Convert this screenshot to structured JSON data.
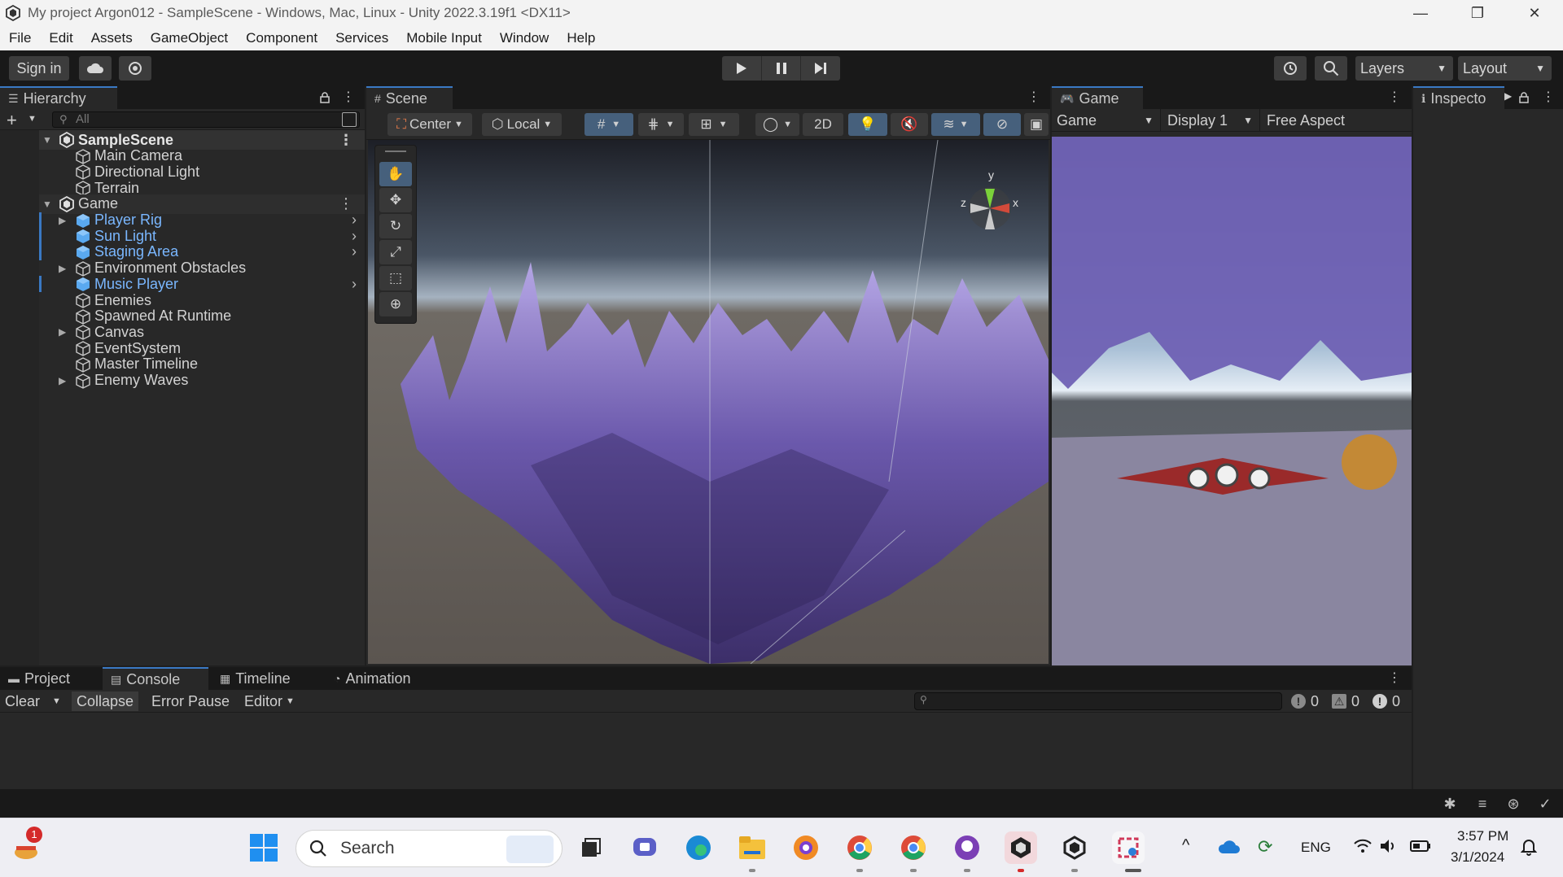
{
  "window": {
    "title": "My project Argon012 - SampleScene - Windows, Mac, Linux - Unity 2022.3.19f1 <DX11>",
    "minimize": "—",
    "maximize": "❐",
    "close": "✕"
  },
  "menu": [
    "File",
    "Edit",
    "Assets",
    "GameObject",
    "Component",
    "Services",
    "Mobile Input",
    "Window",
    "Help"
  ],
  "toolbar": {
    "sign_in": "Sign in",
    "layers": "Layers",
    "layout": "Layout"
  },
  "hierarchy": {
    "tab": "Hierarchy",
    "search_placeholder": "All",
    "rows": [
      {
        "label": "SampleScene"
      },
      {
        "label": "Main Camera"
      },
      {
        "label": "Directional Light"
      },
      {
        "label": "Terrain"
      },
      {
        "label": "Game"
      },
      {
        "label": "Player Rig"
      },
      {
        "label": "Sun Light"
      },
      {
        "label": "Staging Area"
      },
      {
        "label": "Environment Obstacles"
      },
      {
        "label": "Music Player"
      },
      {
        "label": "Enemies"
      },
      {
        "label": "Spawned At Runtime"
      },
      {
        "label": "Canvas"
      },
      {
        "label": "EventSystem"
      },
      {
        "label": "Master Timeline"
      },
      {
        "label": "Enemy Waves"
      }
    ]
  },
  "scene": {
    "tab": "Scene",
    "pivot": "Center",
    "space": "Local",
    "mode_2d": "2D",
    "gizmo_y": "y",
    "gizmo_x": "x",
    "gizmo_z": "z"
  },
  "game": {
    "tab": "Game",
    "mode": "Game",
    "display": "Display 1",
    "aspect": "Free Aspect"
  },
  "inspector": {
    "tab": "Inspecto"
  },
  "bottom": {
    "tabs": [
      "Project",
      "Console",
      "Timeline",
      "Animation"
    ],
    "clear": "Clear",
    "collapse": "Collapse",
    "error_pause": "Error Pause",
    "editor": "Editor",
    "log_count": "0",
    "warn_count": "0",
    "error_count": "0"
  },
  "taskbar": {
    "search": "Search",
    "lang": "ENG",
    "time": "3:57 PM",
    "date": "3/1/2024",
    "badge": "1"
  },
  "colors": {
    "accent": "#3a79c4",
    "prefab_text": "#7ab7ff",
    "panel": "#282828"
  }
}
